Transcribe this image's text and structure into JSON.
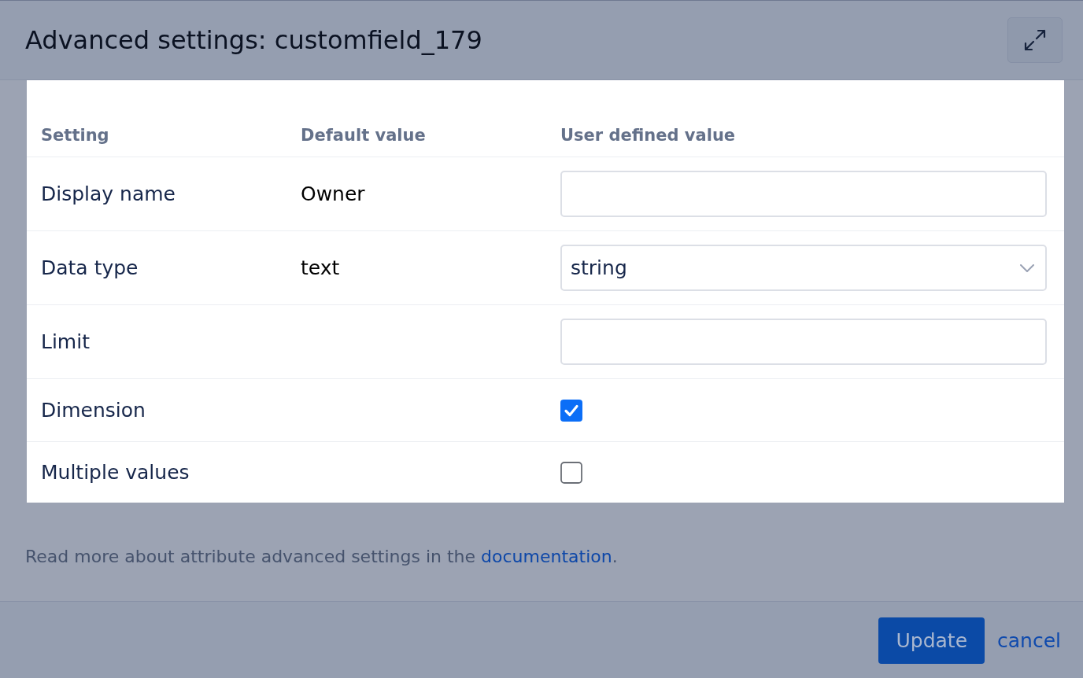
{
  "dialog": {
    "title": "Advanced settings: customfield_179"
  },
  "table": {
    "columns": [
      "Setting",
      "Default value",
      "User defined value"
    ],
    "rows": [
      {
        "setting": "Display name",
        "default_value": "Owner",
        "kind": "text_input"
      },
      {
        "setting": "Data type",
        "default_value": "text",
        "kind": "select",
        "value": "string"
      },
      {
        "setting": "Limit",
        "kind": "text_input"
      },
      {
        "setting": "Dimension",
        "kind": "checkbox",
        "checked": true
      },
      {
        "setting": "Multiple values",
        "kind": "checkbox",
        "checked": false
      }
    ]
  },
  "note": {
    "text": "Read more about attribute advanced settings in the ",
    "link": "documentation",
    "after_link": "."
  },
  "footer": {
    "buttons": [
      {
        "label": "Update",
        "kind": "primary"
      },
      {
        "label": "cancel",
        "kind": "link"
      }
    ]
  }
}
